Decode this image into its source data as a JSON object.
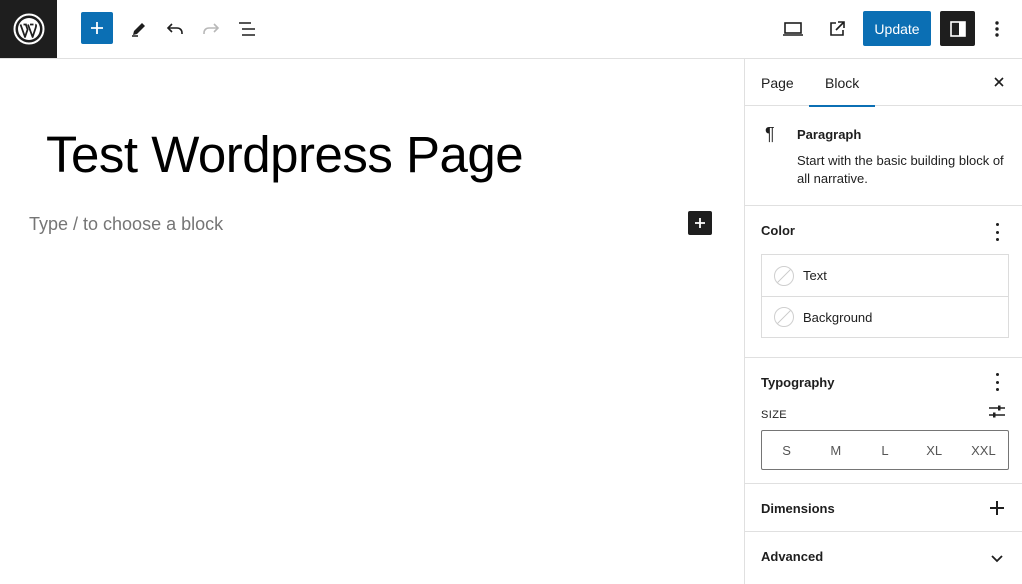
{
  "toolbar": {
    "update_label": "Update"
  },
  "editor": {
    "title": "Test Wordpress Page",
    "placeholder": "Type / to choose a block"
  },
  "sidebar": {
    "tabs": [
      {
        "label": "Page"
      },
      {
        "label": "Block"
      }
    ],
    "block_card": {
      "name": "Paragraph",
      "description": "Start with the basic building block of all narrative."
    },
    "color": {
      "title": "Color",
      "items": [
        {
          "label": "Text"
        },
        {
          "label": "Background"
        }
      ]
    },
    "typography": {
      "title": "Typography",
      "size_label": "SIZE",
      "sizes": [
        "S",
        "M",
        "L",
        "XL",
        "XXL"
      ]
    },
    "dimensions": {
      "title": "Dimensions"
    },
    "advanced": {
      "title": "Advanced"
    }
  },
  "colors": {
    "accent": "#0b6fb4",
    "dark": "#1e1e1e"
  }
}
